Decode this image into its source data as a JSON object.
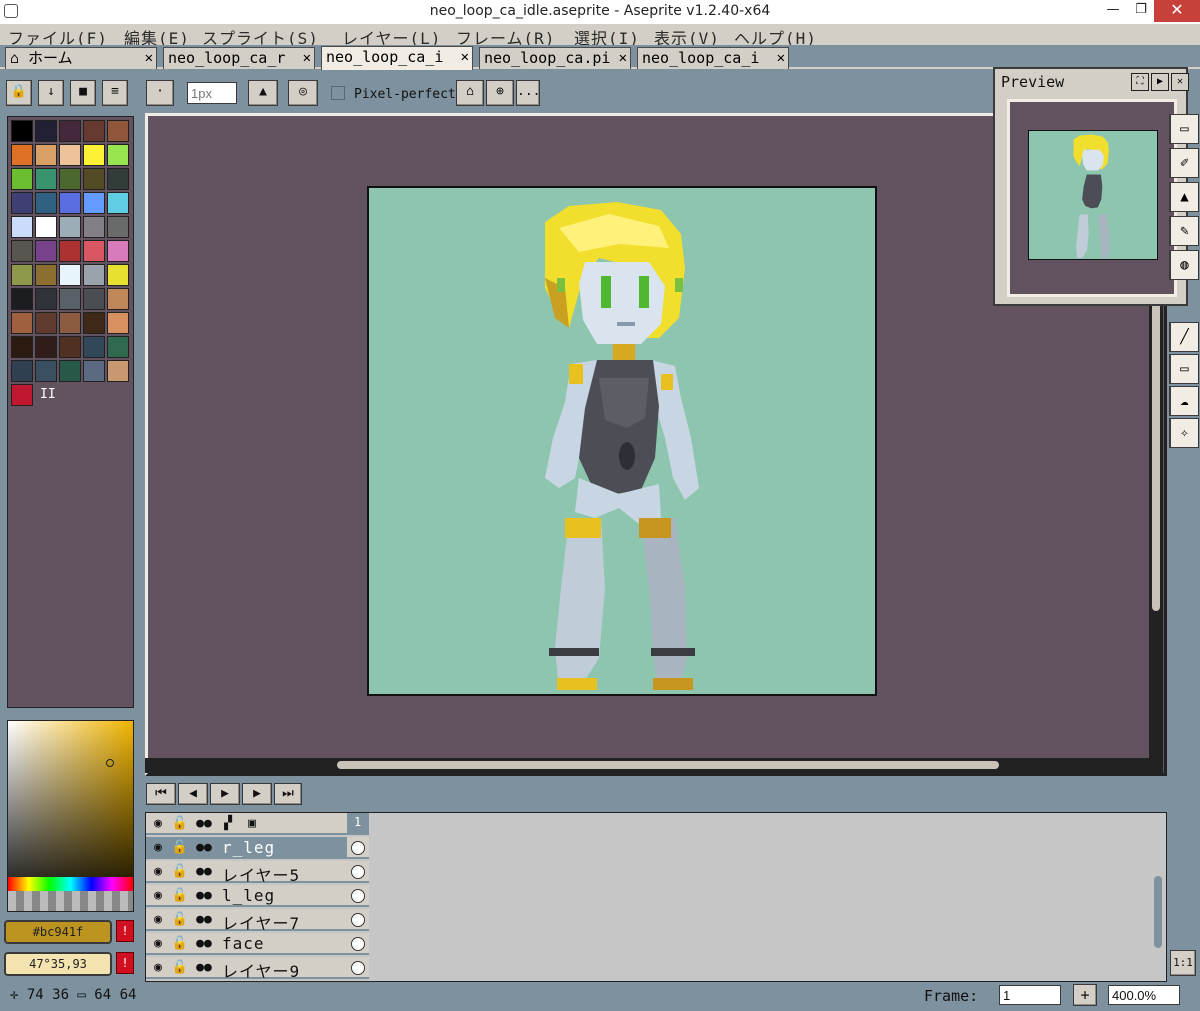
{
  "window": {
    "title": "neo_loop_ca_idle.aseprite - Aseprite v1.2.40-x64",
    "minimize": "—",
    "restore": "❐",
    "close": "✕"
  },
  "menu": [
    "ファイル(F)",
    "編集(E)",
    "スプライト(S)",
    "レイヤー(L)",
    "フレーム(R)",
    "選択(I)",
    "表示(V)",
    "ヘルプ(H)"
  ],
  "tabs": [
    {
      "label": "⌂ ホーム",
      "active": false
    },
    {
      "label": "neo_loop_ca_r",
      "active": false
    },
    {
      "label": "neo_loop_ca_i",
      "active": true
    },
    {
      "label": "neo_loop_ca.pi",
      "active": false
    },
    {
      "label": "neo_loop_ca_i",
      "active": false
    }
  ],
  "context": {
    "brush_size_placeholder": "1px",
    "pixel_perfect_label": "Pixel-perfect",
    "more_label": "..."
  },
  "palette": [
    "#000000",
    "#222034",
    "#45283c",
    "#663931",
    "#8f563b",
    "#df7126",
    "#d9a066",
    "#eec39a",
    "#fbf236",
    "#99e550",
    "#6abe30",
    "#37946e",
    "#4b692f",
    "#524b24",
    "#323c39",
    "#3f3f74",
    "#306082",
    "#5b6ee1",
    "#639bff",
    "#5fcde4",
    "#cbdbfc",
    "#ffffff",
    "#9badb7",
    "#847e87",
    "#696a6a",
    "#595652",
    "#76428a",
    "#ac3232",
    "#d95763",
    "#d77bba",
    "#8f974a",
    "#8a6f30",
    "#e8f4fc",
    "#9aa3ab",
    "#e8e030",
    "#1c1d20",
    "#30343a",
    "#596068",
    "#4a4e52",
    "#c08858",
    "#a06040",
    "#603c30",
    "#8c5c40",
    "#402818",
    "#d89060",
    "#2a1a10",
    "#301c18",
    "#503020",
    "#304858",
    "#306850",
    "#304050",
    "#3a5060",
    "#285848",
    "#5a6a80",
    "#c89870",
    "#c01830"
  ],
  "palette_selected_index_label": "II",
  "colors": {
    "foreground": "#bc941f",
    "foreground_label": "#bc941f",
    "background_label": "47°35,93",
    "background": "#f4e4b0"
  },
  "preview": {
    "title": "Preview"
  },
  "tools": [
    "▭",
    "✐",
    "▲",
    "✎",
    "◍",
    "╱",
    "▭",
    "☁",
    "✧"
  ],
  "timeline": {
    "frame_header": "1",
    "layers": [
      {
        "name": "r_leg",
        "selected": true
      },
      {
        "name": "レイヤー5",
        "selected": false
      },
      {
        "name": "l_leg",
        "selected": false
      },
      {
        "name": "レイヤー7",
        "selected": false
      },
      {
        "name": "face",
        "selected": false
      },
      {
        "name": "レイヤー9",
        "selected": false
      }
    ]
  },
  "status": {
    "position": "✛ 74 36  ▭ 64 64",
    "frame_label": "Frame:",
    "frame_value": "1",
    "add_label": "+",
    "zoom_value": "400.0%",
    "one_to_one": "1:1"
  }
}
